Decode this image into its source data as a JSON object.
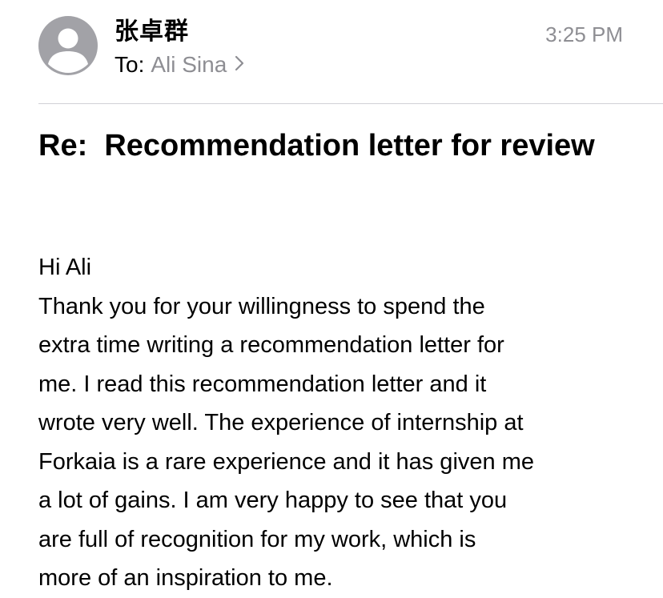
{
  "message": {
    "sender": "张卓群",
    "to_label": "To:",
    "recipient": "Ali Sina",
    "time": "3:25 PM",
    "subject": "Re:  Recommendation letter for review",
    "greeting": "Hi Ali",
    "body_lines": [
      "Thank you for your willingness to spend the",
      "extra time writing a recommendation letter for",
      "me. I read this recommendation letter and it",
      "wrote very well. The experience of internship at",
      "Forkaia is a rare experience and it has given me",
      "a lot of gains. I am very happy to see that you",
      "are full of recognition for my work, which is",
      "more of an inspiration to me."
    ]
  },
  "icons": {
    "avatar": "person-placeholder-icon",
    "recipient_disclosure": "chevron-right-icon"
  },
  "colors": {
    "avatar_bg": "#a2a2a7",
    "secondary_text": "#8e8e93",
    "divider": "#d1d1d6"
  }
}
